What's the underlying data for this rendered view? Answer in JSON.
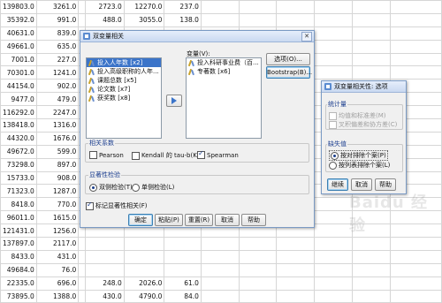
{
  "sheet": {
    "rows": [
      [
        "139803.0",
        "3261.0",
        "",
        "2723.0",
        "12270.0",
        "237.0",
        "",
        "",
        "",
        "",
        "",
        ""
      ],
      [
        "35392.0",
        "991.0",
        "",
        "488.0",
        "3055.0",
        "138.0",
        "",
        "",
        "",
        "",
        "",
        ""
      ],
      [
        "40631.0",
        "839.0",
        "",
        "",
        "",
        "",
        "",
        "",
        "",
        "",
        "",
        ""
      ],
      [
        "49661.0",
        "635.0",
        "",
        "",
        "",
        "",
        "",
        "",
        "",
        "",
        "",
        ""
      ],
      [
        "7001.0",
        "227.0",
        "",
        "",
        "",
        "",
        "",
        "",
        "",
        "",
        "",
        ""
      ],
      [
        "70301.0",
        "1241.0",
        "",
        "",
        "",
        "",
        "",
        "",
        "",
        "",
        "",
        ""
      ],
      [
        "44154.0",
        "902.0",
        "",
        "",
        "",
        "",
        "",
        "",
        "",
        "",
        "",
        ""
      ],
      [
        "9477.0",
        "479.0",
        "",
        "",
        "",
        "",
        "",
        "",
        "",
        "",
        "",
        ""
      ],
      [
        "116292.0",
        "2247.0",
        "",
        "",
        "",
        "",
        "",
        "",
        "",
        "",
        "",
        ""
      ],
      [
        "138418.0",
        "1316.0",
        "",
        "",
        "",
        "",
        "",
        "",
        "",
        "",
        "",
        ""
      ],
      [
        "44320.0",
        "1676.0",
        "",
        "",
        "",
        "",
        "",
        "",
        "",
        "",
        "",
        ""
      ],
      [
        "49672.0",
        "599.0",
        "",
        "",
        "",
        "",
        "",
        "",
        "",
        "",
        "",
        ""
      ],
      [
        "73298.0",
        "897.0",
        "",
        "",
        "",
        "",
        "",
        "",
        "",
        "",
        "",
        ""
      ],
      [
        "15733.0",
        "908.0",
        "",
        "",
        "",
        "",
        "",
        "",
        "",
        "",
        "",
        ""
      ],
      [
        "71323.0",
        "1287.0",
        "",
        "",
        "",
        "",
        "",
        "",
        "",
        "",
        "",
        ""
      ],
      [
        "8418.0",
        "770.0",
        "",
        "",
        "",
        "",
        "",
        "",
        "",
        "",
        "",
        ""
      ],
      [
        "96011.0",
        "1615.0",
        "",
        "",
        "",
        "",
        "",
        "",
        "",
        "",
        "",
        ""
      ],
      [
        "121431.0",
        "1256.0",
        "",
        "",
        "",
        "",
        "",
        "",
        "",
        "",
        "",
        ""
      ],
      [
        "137897.0",
        "2117.0",
        "",
        "",
        "",
        "",
        "",
        "",
        "",
        "",
        "",
        ""
      ],
      [
        "8433.0",
        "431.0",
        "",
        "",
        "",
        "",
        "",
        "",
        "",
        "",
        "",
        ""
      ],
      [
        "49684.0",
        "76.0",
        "",
        "",
        "",
        "",
        "",
        "",
        "",
        "",
        "",
        ""
      ],
      [
        "22335.0",
        "696.0",
        "",
        "248.0",
        "2026.0",
        "61.0",
        "",
        "",
        "",
        "",
        "",
        ""
      ],
      [
        "73895.0",
        "1388.0",
        "",
        "430.0",
        "4790.0",
        "84.0",
        "",
        "",
        "",
        "",
        "",
        ""
      ]
    ]
  },
  "main_dialog": {
    "title": "双变量相关",
    "close_glyph": "✕",
    "source_items": [
      {
        "label": "投入人年数 [x2]",
        "selected": true
      },
      {
        "label": "投入高级职称的人年...",
        "selected": false
      },
      {
        "label": "课题总数 [x5]",
        "selected": false
      },
      {
        "label": "论文数 [x7]",
        "selected": false
      },
      {
        "label": "获奖数 [x8]",
        "selected": false
      }
    ],
    "variables_label": "变量(V):",
    "target_items": [
      {
        "label": "投入科研事业费（百...",
        "selected": false
      },
      {
        "label": "专著数 [x6]",
        "selected": false
      }
    ],
    "options_button": "选项(O)...",
    "bootstrap_button": "Bootstrap(B)...",
    "corr_group_label": "相关系数",
    "pearson_label": "Pearson",
    "pearson_checked": false,
    "kendall_label": "Kendall 的 tau-b(K)",
    "kendall_checked": false,
    "spearman_label": "Spearman",
    "spearman_checked": true,
    "sig_group_label": "显著性检验",
    "two_tailed_label": "双侧检验(T)",
    "two_tailed_selected": true,
    "one_tailed_label": "单侧检验(L)",
    "one_tailed_selected": false,
    "flag_label": "标记显著性相关(F)",
    "flag_checked": true,
    "buttons": [
      "确定",
      "粘贴(P)",
      "重置(R)",
      "取消",
      "帮助"
    ]
  },
  "options_dialog": {
    "title": "双变量相关性: 选项",
    "close_glyph": "✕",
    "stats_group_label": "统计量",
    "means_label": "均值和标准差(M)",
    "crossprod_label": "叉积偏差和协方差(C)",
    "missing_group_label": "缺失值",
    "pairwise_label": "按对排除个案(P)",
    "pairwise_selected": true,
    "listwise_label": "按列表排除个案(L)",
    "listwise_selected": false,
    "buttons": [
      "继续",
      "取消",
      "帮助"
    ]
  },
  "watermark": "Baidu 经验",
  "colors": {
    "selection": "#3b74c9",
    "title_bar": "#c9d9f1",
    "dialog_bg": "#f0f0f0"
  }
}
